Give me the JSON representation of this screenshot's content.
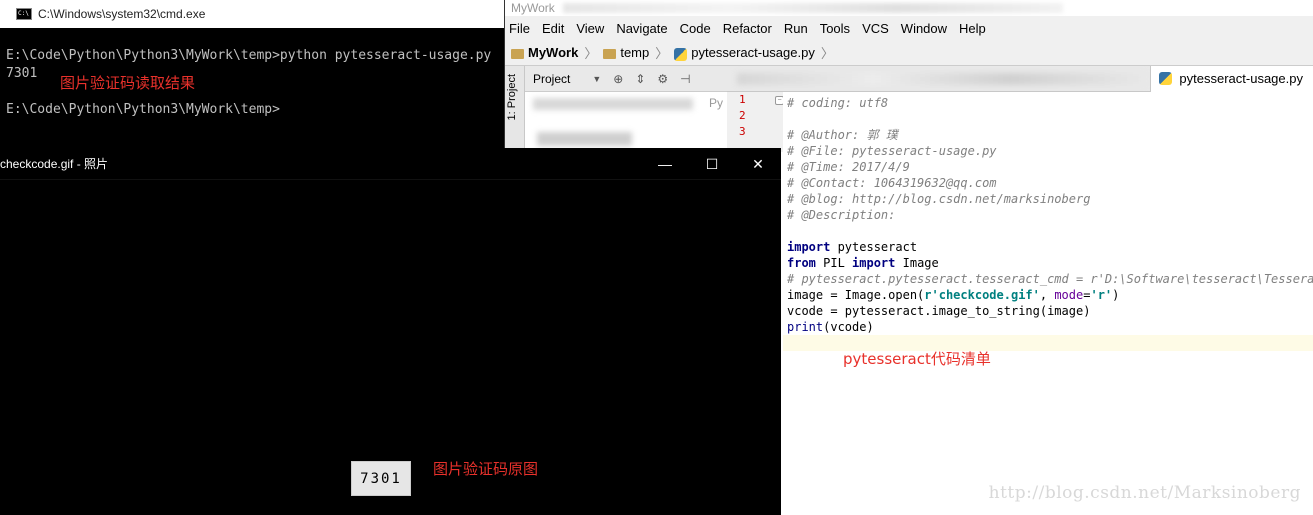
{
  "cmd": {
    "title": "C:\\Windows\\system32\\cmd.exe",
    "lines": [
      "E:\\Code\\Python\\Python3\\MyWork\\temp>python pytesseract-usage.py",
      "7301",
      "",
      "E:\\Code\\Python\\Python3\\MyWork\\temp>"
    ],
    "annotation": "图片验证码读取结果"
  },
  "ide": {
    "title": "MyWork",
    "menu": [
      "File",
      "Edit",
      "View",
      "Navigate",
      "Code",
      "Refactor",
      "Run",
      "Tools",
      "VCS",
      "Window",
      "Help"
    ],
    "breadcrumb": [
      "MyWork",
      "temp",
      "pytesseract-usage.py"
    ],
    "sidebar_tab": "1: Project",
    "project_panel": {
      "label": "Project",
      "partial_text": "Py"
    },
    "active_tab": "pytesseract-usage.py",
    "line_numbers": [
      "1",
      "2",
      "3"
    ],
    "code_lines": [
      "# coding: utf8",
      "",
      "# @Author: 郭 璞",
      "# @File: pytesseract-usage.py",
      "# @Time: 2017/4/9",
      "# @Contact: 1064319632@qq.com",
      "# @blog: http://blog.csdn.net/marksinoberg",
      "# @Description:",
      "",
      "import pytesseract",
      "from PIL import Image",
      "# pytesseract.pytesseract.tesseract_cmd = r'D:\\Software\\tesseract\\Tesseract",
      "image = Image.open(r'checkcode.gif', mode='r')",
      "vcode = pytesseract.image_to_string(image)",
      "print(vcode)"
    ],
    "annotation": "pytesseract代码清单",
    "watermark": "http://blog.csdn.net/Marksinoberg"
  },
  "viewer": {
    "title": "checkcode.gif - 照片",
    "image_text": "7301",
    "annotation": "图片验证码原图",
    "minimize": "—",
    "maximize": "☐",
    "close": "✕"
  },
  "colors": {
    "annotation": "#e8312b",
    "comment": "#808080",
    "keyword": "#000080",
    "string": "#008080"
  }
}
